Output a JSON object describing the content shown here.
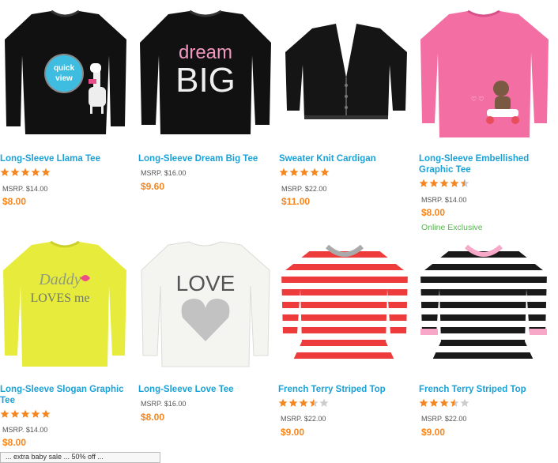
{
  "products": [
    {
      "title": "Long-Sleeve Llama Tee",
      "rating": 5,
      "msrp": "MSRP. $14.00",
      "price": "$8.00",
      "exclusive": "",
      "quick_view": "quick view"
    },
    {
      "title": "Long-Sleeve Dream Big Tee",
      "rating": 0,
      "msrp": "MSRP. $16.00",
      "price": "$9.60",
      "exclusive": "",
      "shirt_text_1": "dream",
      "shirt_text_2": "BIG"
    },
    {
      "title": "Sweater Knit Cardigan",
      "rating": 5,
      "msrp": "MSRP. $22.00",
      "price": "$11.00",
      "exclusive": ""
    },
    {
      "title": "Long-Sleeve Embellished Graphic Tee",
      "rating": 4.5,
      "msrp": "MSRP. $14.00",
      "price": "$8.00",
      "exclusive": "Online Exclusive"
    },
    {
      "title": "Long-Sleeve Slogan Graphic Tee",
      "rating": 5,
      "msrp": "MSRP. $14.00",
      "price": "$8.00",
      "exclusive": "",
      "shirt_text_1": "Daddy",
      "shirt_text_2": "LOVES me"
    },
    {
      "title": "Long-Sleeve Love Tee",
      "rating": 0,
      "msrp": "MSRP. $16.00",
      "price": "$8.00",
      "exclusive": "",
      "shirt_text_1": "LOVE"
    },
    {
      "title": "French Terry Striped Top",
      "rating": 3.5,
      "msrp": "MSRP. $22.00",
      "price": "$9.00",
      "exclusive": ""
    },
    {
      "title": "French Terry Striped Top",
      "rating": 3.5,
      "msrp": "MSRP. $22.00",
      "price": "$9.00",
      "exclusive": ""
    }
  ],
  "bottom_bar": "... extra baby sale ... 50% off ...",
  "colors": {
    "title": "#1aa1d6",
    "price": "#f5861f",
    "star": "#f5861f",
    "star_empty": "#cccccc",
    "exclusive": "#5ab552"
  }
}
